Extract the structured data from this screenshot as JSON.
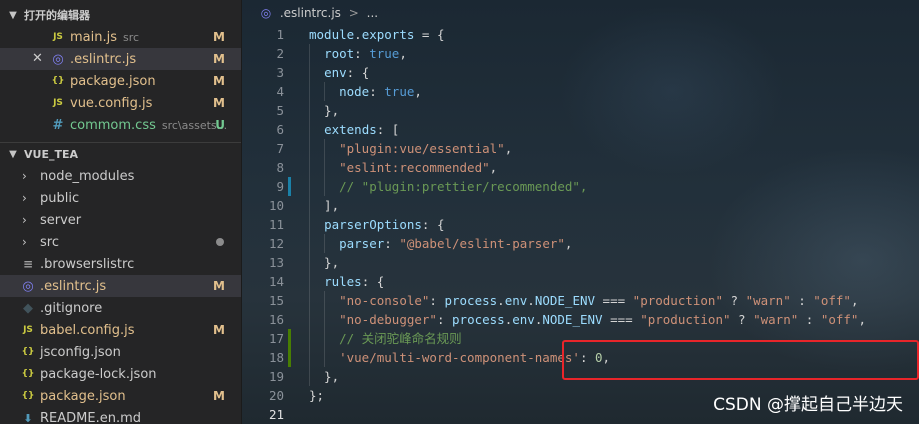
{
  "explorer": {
    "open_editors": {
      "header": "打开的编辑器",
      "files": [
        {
          "icon": "js-file-icon",
          "glyph": "JS",
          "name": "main.js",
          "desc": "src",
          "badge": "M"
        },
        {
          "icon": "eslint-file-icon",
          "glyph": "◎",
          "name": ".eslintrc.js",
          "desc": "",
          "badge": "M",
          "selected": true,
          "close": "✕"
        },
        {
          "icon": "json-file-icon",
          "glyph": "{}",
          "name": "package.json",
          "desc": "",
          "badge": "M"
        },
        {
          "icon": "js-file-icon",
          "glyph": "JS",
          "name": "vue.config.js",
          "desc": "",
          "badge": "M"
        },
        {
          "icon": "css-file-icon",
          "glyph": "#",
          "name": "commom.css",
          "desc": "src\\assets...",
          "badge": "U"
        }
      ]
    },
    "project": {
      "header": "VUE_TEA",
      "items": [
        {
          "type": "folder",
          "name": "node_modules"
        },
        {
          "type": "folder",
          "name": "public"
        },
        {
          "type": "folder",
          "name": "server"
        },
        {
          "type": "folder",
          "name": "src",
          "dot": true
        },
        {
          "type": "file",
          "icon": "browserslist-file-icon",
          "glyph": "≡",
          "name": ".browserslistrc"
        },
        {
          "type": "file",
          "icon": "eslint-file-icon",
          "glyph": "◎",
          "name": ".eslintrc.js",
          "badge": "M",
          "selected": true
        },
        {
          "type": "file",
          "icon": "git-file-icon",
          "glyph": "◆",
          "name": ".gitignore"
        },
        {
          "type": "file",
          "icon": "js-file-icon",
          "glyph": "JS",
          "name": "babel.config.js",
          "badge": "M"
        },
        {
          "type": "file",
          "icon": "json-file-icon",
          "glyph": "{}",
          "name": "jsconfig.json"
        },
        {
          "type": "file",
          "icon": "json-file-icon",
          "glyph": "{}",
          "name": "package-lock.json"
        },
        {
          "type": "file",
          "icon": "json-file-icon",
          "glyph": "{}",
          "name": "package.json",
          "badge": "M"
        },
        {
          "type": "file",
          "icon": "readme-file-icon",
          "glyph": "⬇",
          "name": "README.en.md"
        }
      ]
    }
  },
  "editor": {
    "breadcrumb": {
      "file": ".eslintrc.js",
      "separator": ">",
      "tail": "..."
    },
    "lines": [
      {
        "n": "1",
        "tokens": [
          [
            "module",
            "ident"
          ],
          [
            ".",
            "pl"
          ],
          [
            "exports",
            "ident"
          ],
          [
            " = {",
            "pl"
          ]
        ]
      },
      {
        "n": "2",
        "tokens": [
          [
            "  ",
            "pl"
          ],
          [
            "root",
            "ident"
          ],
          [
            ": ",
            "pl"
          ],
          [
            "true",
            "kw"
          ],
          [
            ",",
            "pl"
          ]
        ]
      },
      {
        "n": "3",
        "tokens": [
          [
            "  ",
            "pl"
          ],
          [
            "env",
            "ident"
          ],
          [
            ": {",
            "pl"
          ]
        ]
      },
      {
        "n": "4",
        "tokens": [
          [
            "    ",
            "pl"
          ],
          [
            "node",
            "ident"
          ],
          [
            ": ",
            "pl"
          ],
          [
            "true",
            "kw"
          ],
          [
            ",",
            "pl"
          ]
        ]
      },
      {
        "n": "5",
        "tokens": [
          [
            "  },",
            "pl"
          ]
        ]
      },
      {
        "n": "6",
        "tokens": [
          [
            "  ",
            "pl"
          ],
          [
            "extends",
            "ident"
          ],
          [
            ": [",
            "pl"
          ]
        ]
      },
      {
        "n": "7",
        "tokens": [
          [
            "    ",
            "pl"
          ],
          [
            "\"plugin:vue/essential\"",
            "str"
          ],
          [
            ",",
            "pl"
          ]
        ]
      },
      {
        "n": "8",
        "tokens": [
          [
            "    ",
            "pl"
          ],
          [
            "\"eslint:recommended\"",
            "str"
          ],
          [
            ",",
            "pl"
          ]
        ]
      },
      {
        "n": "9",
        "gutter": "blue",
        "tokens": [
          [
            "    ",
            "pl"
          ],
          [
            "// \"plugin:prettier/recommended\",",
            "cm"
          ]
        ]
      },
      {
        "n": "10",
        "tokens": [
          [
            "  ],",
            "pl"
          ]
        ]
      },
      {
        "n": "11",
        "tokens": [
          [
            "  ",
            "pl"
          ],
          [
            "parserOptions",
            "ident"
          ],
          [
            ": {",
            "pl"
          ]
        ]
      },
      {
        "n": "12",
        "tokens": [
          [
            "    ",
            "pl"
          ],
          [
            "parser",
            "ident"
          ],
          [
            ": ",
            "pl"
          ],
          [
            "\"@babel/eslint-parser\"",
            "str"
          ],
          [
            ",",
            "pl"
          ]
        ]
      },
      {
        "n": "13",
        "tokens": [
          [
            "  },",
            "pl"
          ]
        ]
      },
      {
        "n": "14",
        "tokens": [
          [
            "  ",
            "pl"
          ],
          [
            "rules",
            "ident"
          ],
          [
            ": {",
            "pl"
          ]
        ]
      },
      {
        "n": "15",
        "tokens": [
          [
            "    ",
            "pl"
          ],
          [
            "\"no-console\"",
            "str"
          ],
          [
            ": ",
            "pl"
          ],
          [
            "process",
            "ident"
          ],
          [
            ".",
            "pl"
          ],
          [
            "env",
            "ident"
          ],
          [
            ".",
            "pl"
          ],
          [
            "NODE_ENV",
            "ident"
          ],
          [
            " === ",
            "pl"
          ],
          [
            "\"production\"",
            "str"
          ],
          [
            " ? ",
            "pl"
          ],
          [
            "\"warn\"",
            "str"
          ],
          [
            " : ",
            "pl"
          ],
          [
            "\"off\"",
            "str"
          ],
          [
            ",",
            "pl"
          ]
        ]
      },
      {
        "n": "16",
        "tokens": [
          [
            "    ",
            "pl"
          ],
          [
            "\"no-debugger\"",
            "str"
          ],
          [
            ": ",
            "pl"
          ],
          [
            "process",
            "ident"
          ],
          [
            ".",
            "pl"
          ],
          [
            "env",
            "ident"
          ],
          [
            ".",
            "pl"
          ],
          [
            "NODE_ENV",
            "ident"
          ],
          [
            " === ",
            "pl"
          ],
          [
            "\"production\"",
            "str"
          ],
          [
            " ? ",
            "pl"
          ],
          [
            "\"warn\"",
            "str"
          ],
          [
            " : ",
            "pl"
          ],
          [
            "\"off\"",
            "str"
          ],
          [
            ",",
            "pl"
          ]
        ]
      },
      {
        "n": "17",
        "gutter": "green",
        "tokens": [
          [
            "    ",
            "pl"
          ],
          [
            "// 关闭驼峰命名规则",
            "cm"
          ]
        ]
      },
      {
        "n": "18",
        "gutter": "green",
        "tokens": [
          [
            "    ",
            "pl"
          ],
          [
            "'vue/multi-word-component-names'",
            "str"
          ],
          [
            ": ",
            "pl"
          ],
          [
            "0",
            "num"
          ],
          [
            ",",
            "pl"
          ]
        ]
      },
      {
        "n": "19",
        "tokens": [
          [
            "  },",
            "pl"
          ]
        ]
      },
      {
        "n": "20",
        "tokens": [
          [
            "};",
            "pl"
          ]
        ]
      },
      {
        "n": "21",
        "current": true,
        "tokens": []
      }
    ],
    "watermark": "CSDN @撑起自己半边天"
  },
  "colors": {
    "ident": "#9cdcfe",
    "str": "#ce9178",
    "kw": "#569cd6",
    "num": "#b5cea8",
    "cm": "#6a9955",
    "pl": "#d4d4d4",
    "modified": "#e2c08d",
    "untracked": "#73c991",
    "highlight_box": "#e8252a"
  }
}
